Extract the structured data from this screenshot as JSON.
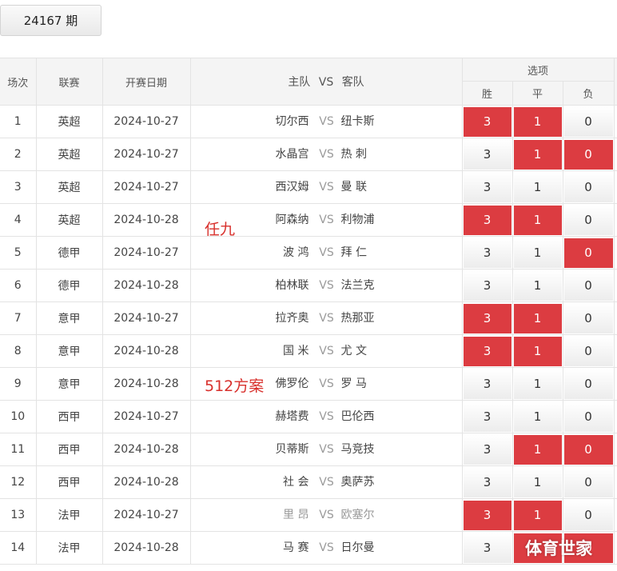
{
  "period": {
    "label": "24167 期"
  },
  "headers": {
    "index": "场次",
    "league": "联赛",
    "date": "开赛日期",
    "home": "主队",
    "vs": "VS",
    "away": "客队",
    "options": "选项",
    "win": "胜",
    "draw": "平",
    "lose": "负"
  },
  "rows": [
    {
      "no": "1",
      "league": "英超",
      "date": "2024-10-27",
      "home": "切尔西",
      "vs": "VS",
      "away": "纽卡斯",
      "w": "3",
      "d": "1",
      "l": "0",
      "w_sel": true,
      "d_sel": true,
      "l_sel": false
    },
    {
      "no": "2",
      "league": "英超",
      "date": "2024-10-27",
      "home": "水晶宫",
      "vs": "VS",
      "away": "热 刺",
      "w": "3",
      "d": "1",
      "l": "0",
      "w_sel": false,
      "d_sel": true,
      "l_sel": true
    },
    {
      "no": "3",
      "league": "英超",
      "date": "2024-10-27",
      "home": "西汉姆",
      "vs": "VS",
      "away": "曼 联",
      "w": "3",
      "d": "1",
      "l": "0",
      "w_sel": false,
      "d_sel": false,
      "l_sel": false
    },
    {
      "no": "4",
      "league": "英超",
      "date": "2024-10-28",
      "home": "阿森纳",
      "vs": "VS",
      "away": "利物浦",
      "w": "3",
      "d": "1",
      "l": "0",
      "w_sel": true,
      "d_sel": true,
      "l_sel": false
    },
    {
      "no": "5",
      "league": "德甲",
      "date": "2024-10-27",
      "home": "波 鸿",
      "vs": "VS",
      "away": "拜 仁",
      "w": "3",
      "d": "1",
      "l": "0",
      "w_sel": false,
      "d_sel": false,
      "l_sel": true
    },
    {
      "no": "6",
      "league": "德甲",
      "date": "2024-10-28",
      "home": "柏林联",
      "vs": "VS",
      "away": "法兰克",
      "w": "3",
      "d": "1",
      "l": "0",
      "w_sel": false,
      "d_sel": false,
      "l_sel": false
    },
    {
      "no": "7",
      "league": "意甲",
      "date": "2024-10-27",
      "home": "拉齐奥",
      "vs": "VS",
      "away": "热那亚",
      "w": "3",
      "d": "1",
      "l": "0",
      "w_sel": true,
      "d_sel": true,
      "l_sel": false
    },
    {
      "no": "8",
      "league": "意甲",
      "date": "2024-10-28",
      "home": "国 米",
      "vs": "VS",
      "away": "尤 文",
      "w": "3",
      "d": "1",
      "l": "0",
      "w_sel": true,
      "d_sel": true,
      "l_sel": false
    },
    {
      "no": "9",
      "league": "意甲",
      "date": "2024-10-28",
      "home": "佛罗伦",
      "vs": "VS",
      "away": "罗 马",
      "w": "3",
      "d": "1",
      "l": "0",
      "w_sel": false,
      "d_sel": false,
      "l_sel": false
    },
    {
      "no": "10",
      "league": "西甲",
      "date": "2024-10-27",
      "home": "赫塔费",
      "vs": "VS",
      "away": "巴伦西",
      "w": "3",
      "d": "1",
      "l": "0",
      "w_sel": false,
      "d_sel": false,
      "l_sel": false
    },
    {
      "no": "11",
      "league": "西甲",
      "date": "2024-10-28",
      "home": "贝蒂斯",
      "vs": "VS",
      "away": "马竞技",
      "w": "3",
      "d": "1",
      "l": "0",
      "w_sel": false,
      "d_sel": true,
      "l_sel": true
    },
    {
      "no": "12",
      "league": "西甲",
      "date": "2024-10-28",
      "home": "社 会",
      "vs": "VS",
      "away": "奥萨苏",
      "w": "3",
      "d": "1",
      "l": "0",
      "w_sel": false,
      "d_sel": false,
      "l_sel": false
    },
    {
      "no": "13",
      "league": "法甲",
      "date": "2024-10-27",
      "home": "里 昂",
      "vs": "VS",
      "away": "欧塞尔",
      "w": "3",
      "d": "1",
      "l": "0",
      "w_sel": true,
      "d_sel": true,
      "l_sel": false,
      "dim": true
    },
    {
      "no": "14",
      "league": "法甲",
      "date": "2024-10-28",
      "home": "马 赛",
      "vs": "VS",
      "away": "日尔曼",
      "w": "3",
      "d": "1",
      "l": "0",
      "w_sel": false,
      "d_sel": true,
      "l_sel": true
    }
  ],
  "annotations": {
    "renjiu": "任九",
    "plan512": "512方案"
  },
  "watermark": "体育世家",
  "colors": {
    "selected": "#dc3c41",
    "annotation": "#d8302c"
  }
}
